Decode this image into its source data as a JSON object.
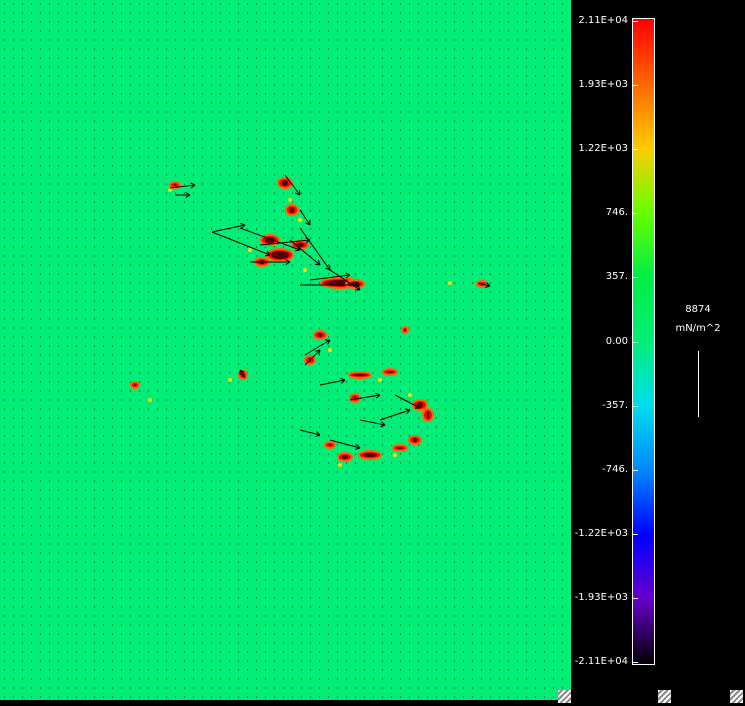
{
  "chart_data": {
    "type": "heatmap",
    "title": "",
    "xlabel": "",
    "ylabel": "",
    "colorbar": {
      "unit": "mN/m^2",
      "ticks": [
        "2.11E+04",
        "1.93E+03",
        "1.22E+03",
        "746.",
        "357.",
        "0.00",
        "-357.",
        "-746.",
        "-1.22E+03",
        "-1.93E+03",
        "-2.11E+04"
      ],
      "colors": [
        "#ff0000",
        "#ff6600",
        "#ffcc00",
        "#66ff00",
        "#00ee44",
        "#00ee77",
        "#00ddee",
        "#0088ff",
        "#0000ff",
        "#6600cc",
        "#000000"
      ]
    },
    "vector_scale": {
      "value": "8874",
      "unit": "mN/m^2"
    },
    "background_value": "0.00",
    "features": [
      "vector field arrows",
      "stress hot spots in red/orange near center"
    ]
  },
  "ui": {
    "resize_handles": [
      "handle-1",
      "handle-2",
      "handle-3"
    ]
  }
}
